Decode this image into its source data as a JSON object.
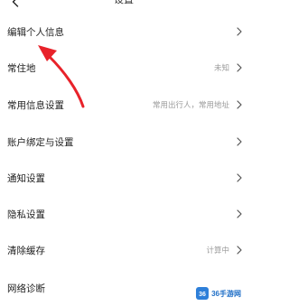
{
  "header": {
    "title": "设置",
    "back_icon": "chevron-left-icon"
  },
  "rows": [
    {
      "label": "编辑个人信息",
      "value": ""
    },
    {
      "label": "常住地",
      "value": "未知"
    },
    {
      "label": "常用信息设置",
      "value": "常用出行人，常用地址"
    },
    {
      "label": "账户绑定与设置",
      "value": ""
    },
    {
      "label": "通知设置",
      "value": ""
    },
    {
      "label": "隐私设置",
      "value": ""
    },
    {
      "label": "清除缓存",
      "value": "计算中"
    },
    {
      "label": "网络诊断",
      "value": ""
    }
  ],
  "annotation": {
    "arrow_color": "#e8222a"
  },
  "watermark": {
    "text": "36手游网",
    "logo_text": "36",
    "logo_color": "#2e7fd9"
  }
}
